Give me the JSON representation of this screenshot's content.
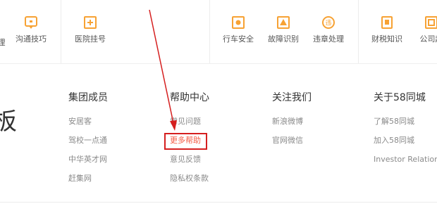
{
  "toolbar": {
    "items": [
      {
        "label": "",
        "icon": "partial-icon"
      },
      {
        "label": "沟通技巧",
        "icon": "chat-board-icon"
      },
      {
        "label": "医院挂号",
        "icon": "plus-board-icon"
      },
      {
        "label": "行车安全",
        "icon": "car-safe-icon"
      },
      {
        "label": "故障识别",
        "icon": "warning-board-icon"
      },
      {
        "label": "违章处理",
        "icon": "violation-badge-icon"
      },
      {
        "label": "财税知识",
        "icon": "ledger-icon"
      },
      {
        "label": "公司起",
        "icon": "company-board-icon"
      }
    ]
  },
  "footer": {
    "partial_char": "板",
    "columns": [
      {
        "title": "集团成员",
        "links": [
          "安居客",
          "驾校一点通",
          "中华英才网",
          "赶集网"
        ]
      },
      {
        "title": "帮助中心",
        "links": [
          "常见问题",
          "更多帮助",
          "意见反馈",
          "隐私权条款"
        ]
      },
      {
        "title": "关注我们",
        "links": [
          "新浪微博",
          "官网微信"
        ]
      },
      {
        "title": "关于58同城",
        "links": [
          "了解58同城",
          "加入58同城",
          "Investor Relations"
        ]
      }
    ],
    "highlighted_link": "更多帮助"
  },
  "colors": {
    "accent_orange": "#f7a234",
    "highlight_link": "#f45b44",
    "annotation_red": "#d51f1f"
  }
}
